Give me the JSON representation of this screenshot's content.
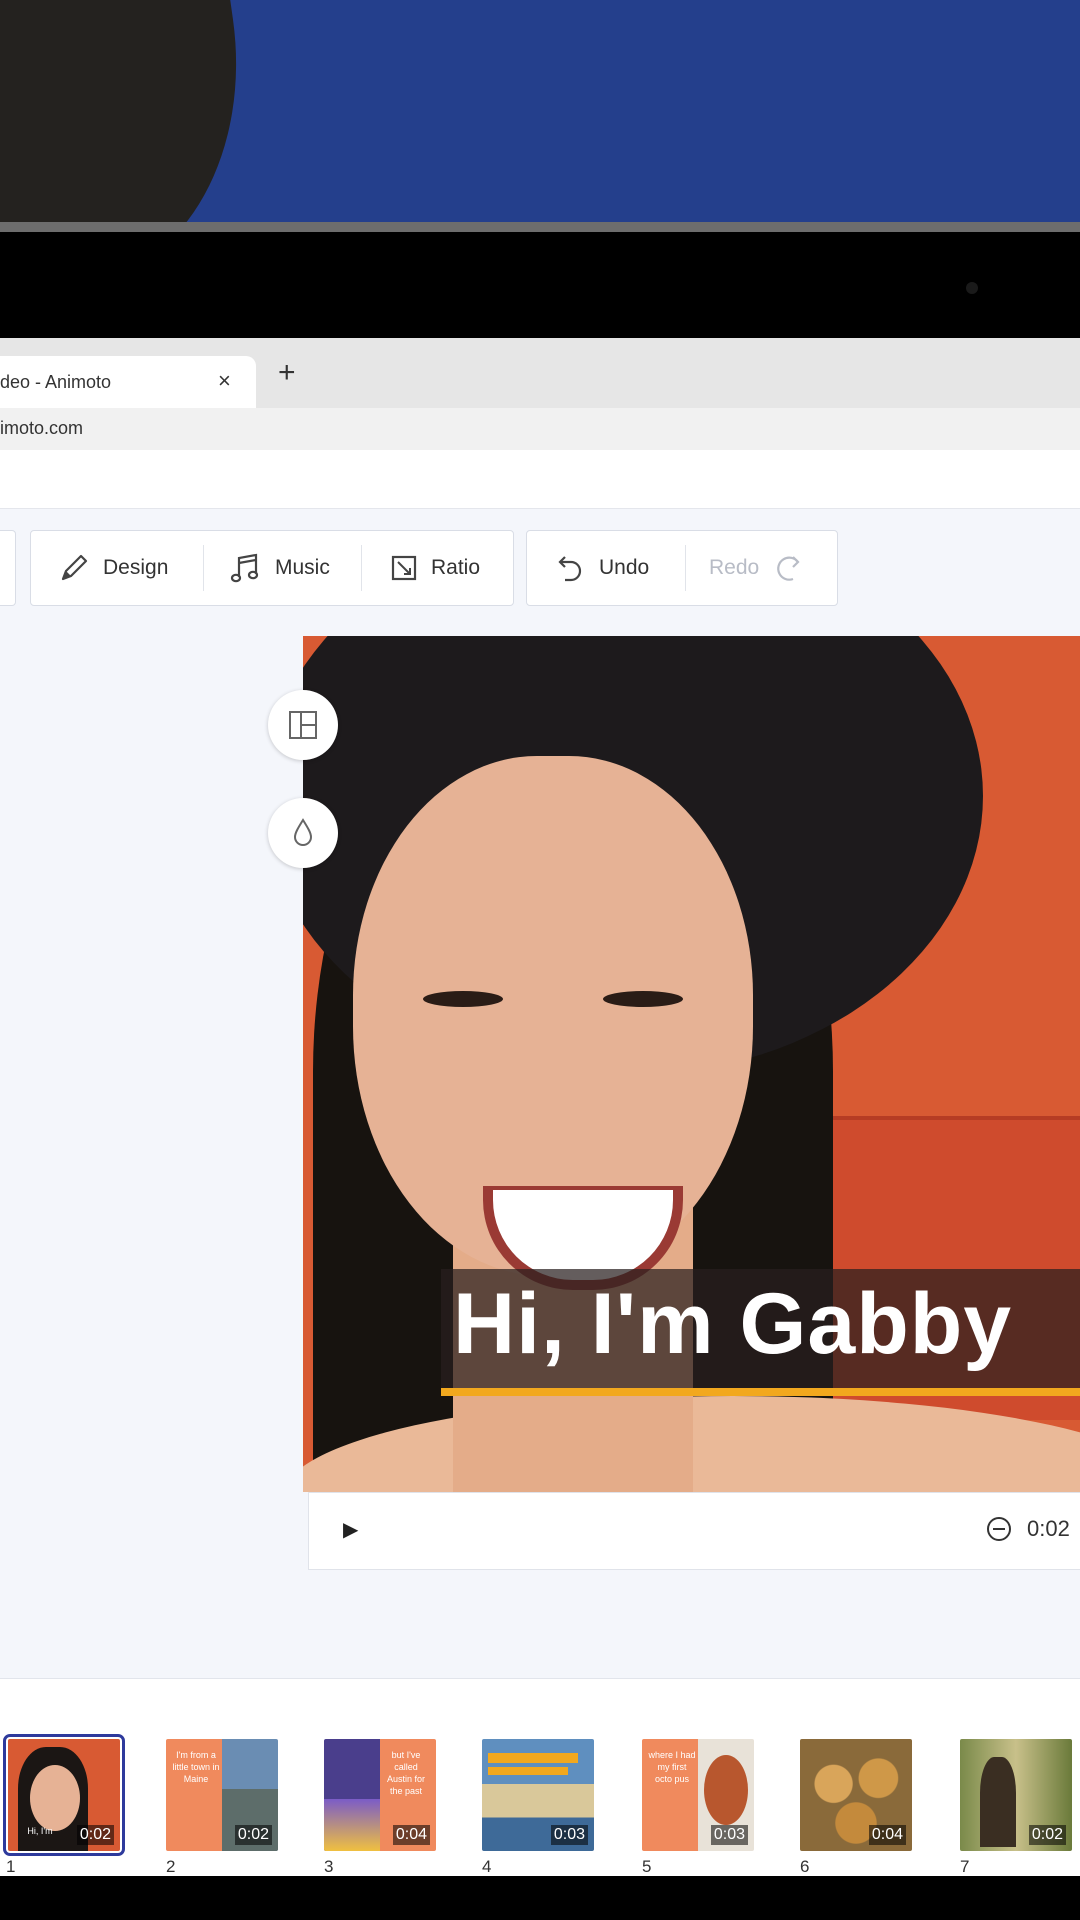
{
  "browser": {
    "tab_title": "deo - Animoto",
    "tab_close": "×",
    "new_tab": "+",
    "url": "imoto.com"
  },
  "toolbar": {
    "design_label": "Design",
    "music_label": "Music",
    "ratio_label": "Ratio",
    "undo_label": "Undo",
    "redo_label": "Redo"
  },
  "canvas": {
    "caption": "Hi, I'm Gabby",
    "caption_bar_color": "#f2a81e",
    "background_color": "#d85a33"
  },
  "player": {
    "play_icon": "▶",
    "time": "0:02"
  },
  "timeline": {
    "selected_index": 0,
    "accent_color": "#2e3a9c",
    "blocks": [
      {
        "number": "1",
        "duration": "0:02",
        "text": "Hi, I'm"
      },
      {
        "number": "2",
        "duration": "0:02",
        "text": "I'm from a little town in Maine"
      },
      {
        "number": "3",
        "duration": "0:04",
        "text": "but I've called Austin for the past"
      },
      {
        "number": "4",
        "duration": "0:03",
        "text": ""
      },
      {
        "number": "5",
        "duration": "0:03",
        "text": "where I had my first octo pus"
      },
      {
        "number": "6",
        "duration": "0:04",
        "text": ""
      },
      {
        "number": "7",
        "duration": "0:02",
        "text": ""
      }
    ]
  }
}
